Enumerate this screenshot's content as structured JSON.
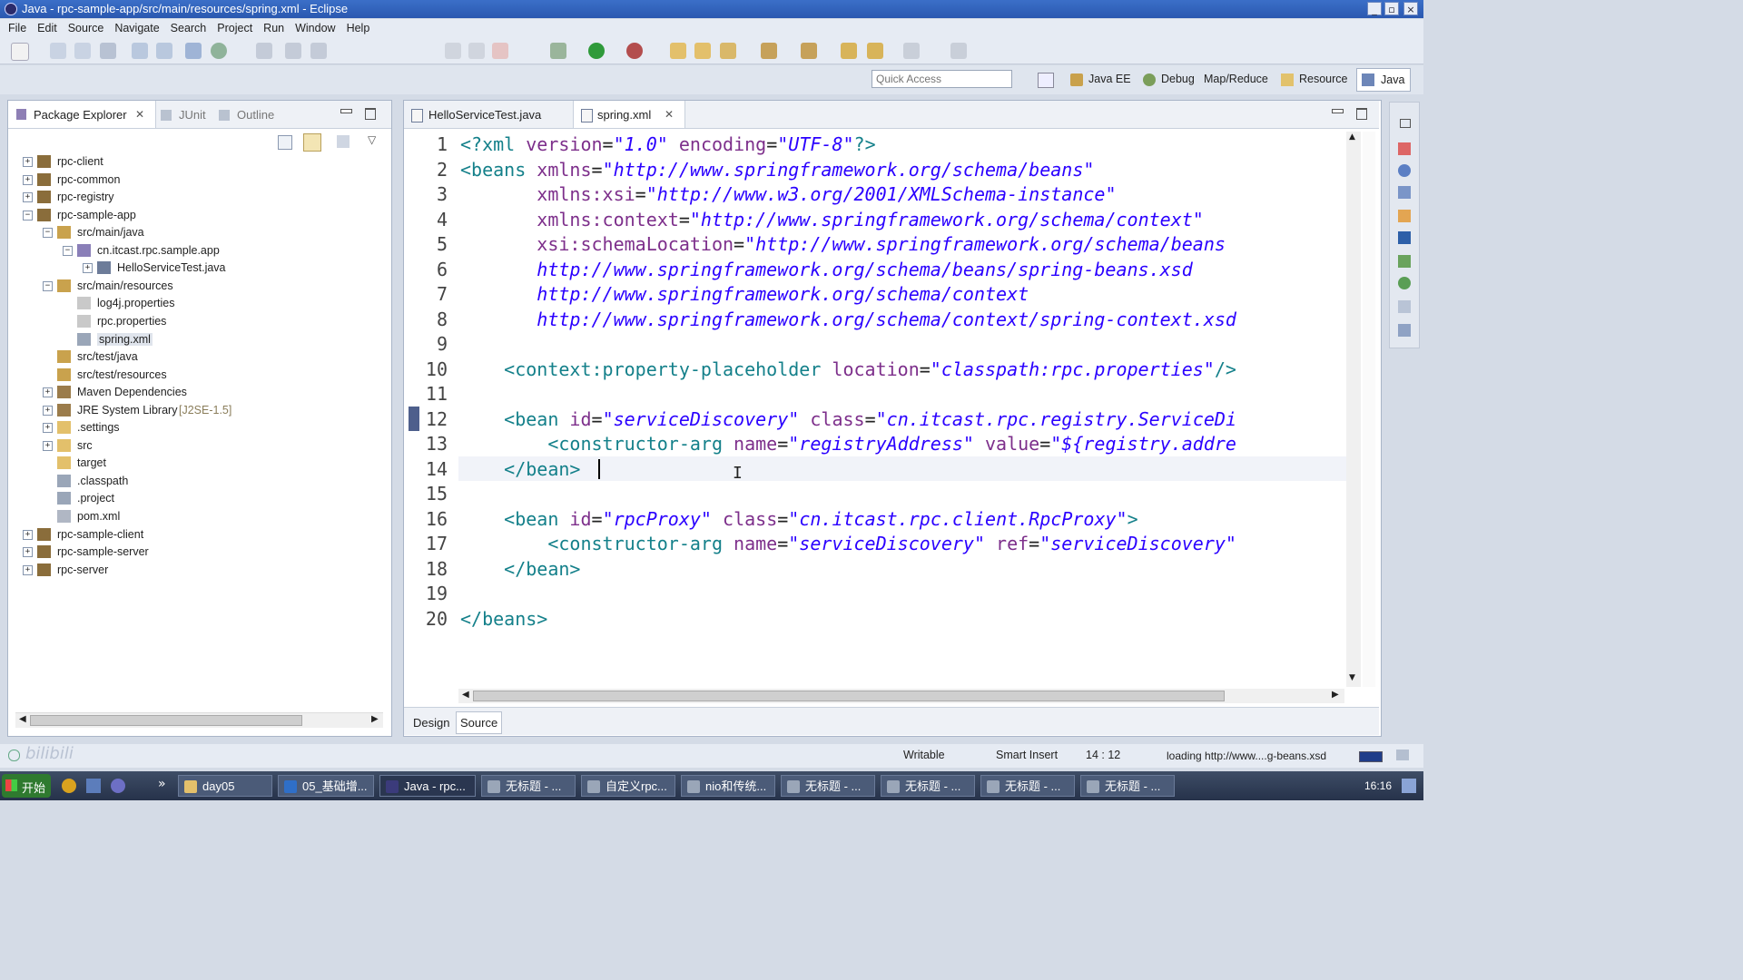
{
  "window": {
    "title": "Java - rpc-sample-app/src/main/resources/spring.xml - Eclipse",
    "controls": [
      "_",
      "▫",
      "×"
    ]
  },
  "menu": [
    "File",
    "Edit",
    "Source",
    "Navigate",
    "Search",
    "Project",
    "Run",
    "Window",
    "Help"
  ],
  "quick_access": {
    "placeholder": "Quick Access"
  },
  "perspectives": [
    "Java EE",
    "Debug",
    "Map/Reduce",
    "Resource",
    "Java"
  ],
  "left_panel": {
    "tabs": [
      "Package Explorer",
      "JUnit",
      "Outline"
    ],
    "tree": [
      {
        "label": "rpc-client",
        "expander": "+"
      },
      {
        "label": "rpc-common",
        "expander": "+"
      },
      {
        "label": "rpc-registry",
        "expander": "+"
      },
      {
        "label": "rpc-sample-app",
        "expander": "−"
      },
      {
        "label": "src/main/java",
        "expander": "−"
      },
      {
        "label": "cn.itcast.rpc.sample.app",
        "expander": "−"
      },
      {
        "label": "HelloServiceTest.java",
        "expander": "+"
      },
      {
        "label": "src/main/resources",
        "expander": "−"
      },
      {
        "label": "log4j.properties",
        "expander": ""
      },
      {
        "label": "rpc.properties",
        "expander": ""
      },
      {
        "label": "spring.xml",
        "expander": ""
      },
      {
        "label": "src/test/java",
        "expander": ""
      },
      {
        "label": "src/test/resources",
        "expander": ""
      },
      {
        "label": "Maven Dependencies",
        "expander": "+"
      },
      {
        "label": "JRE System Library",
        "suffix": "[J2SE-1.5]",
        "expander": "+"
      },
      {
        "label": ".settings",
        "expander": "+"
      },
      {
        "label": "src",
        "expander": "+"
      },
      {
        "label": "target",
        "expander": ""
      },
      {
        "label": ".classpath",
        "expander": ""
      },
      {
        "label": ".project",
        "expander": ""
      },
      {
        "label": "pom.xml",
        "expander": ""
      },
      {
        "label": "rpc-sample-client",
        "expander": "+"
      },
      {
        "label": "rpc-sample-server",
        "expander": "+"
      },
      {
        "label": "rpc-server",
        "expander": "+"
      }
    ]
  },
  "editor": {
    "tabs": [
      "HelloServiceTest.java",
      "spring.xml"
    ],
    "bottom_tabs": [
      "Design",
      "Source"
    ],
    "lines": [
      {
        "n": "1",
        "segs": [
          [
            "pi",
            "<?xml "
          ],
          [
            "attr",
            "version"
          ],
          [
            "txt",
            "="
          ],
          [
            "str",
            "\"1.0\""
          ],
          [
            "txt",
            " "
          ],
          [
            "attr",
            "encoding"
          ],
          [
            "txt",
            "="
          ],
          [
            "str",
            "\"UTF-8\""
          ],
          [
            "pi",
            "?>"
          ]
        ]
      },
      {
        "n": "2",
        "segs": [
          [
            "tag",
            "<beans "
          ],
          [
            "attr",
            "xmlns"
          ],
          [
            "txt",
            "="
          ],
          [
            "str",
            "\"http://www.springframework.org/schema/beans\""
          ]
        ]
      },
      {
        "n": "3",
        "segs": [
          [
            "txt",
            "       "
          ],
          [
            "attr",
            "xmlns:xsi"
          ],
          [
            "txt",
            "="
          ],
          [
            "str",
            "\"http://www.w3.org/2001/XMLSchema-instance\""
          ]
        ]
      },
      {
        "n": "4",
        "segs": [
          [
            "txt",
            "       "
          ],
          [
            "attr",
            "xmlns:context"
          ],
          [
            "txt",
            "="
          ],
          [
            "str",
            "\"http://www.springframework.org/schema/context\""
          ]
        ]
      },
      {
        "n": "5",
        "segs": [
          [
            "txt",
            "       "
          ],
          [
            "attr",
            "xsi:schemaLocation"
          ],
          [
            "txt",
            "="
          ],
          [
            "str",
            "\"http://www.springframework.org/schema/beans"
          ]
        ]
      },
      {
        "n": "6",
        "segs": [
          [
            "txt",
            "       "
          ],
          [
            "str",
            "http://www.springframework.org/schema/beans/spring-beans.xsd"
          ]
        ]
      },
      {
        "n": "7",
        "segs": [
          [
            "txt",
            "       "
          ],
          [
            "str",
            "http://www.springframework.org/schema/context"
          ]
        ]
      },
      {
        "n": "8",
        "segs": [
          [
            "txt",
            "       "
          ],
          [
            "str",
            "http://www.springframework.org/schema/context/spring-context.xsd"
          ]
        ]
      },
      {
        "n": "9",
        "segs": []
      },
      {
        "n": "10",
        "segs": [
          [
            "txt",
            "    "
          ],
          [
            "tag",
            "<context:property-placeholder "
          ],
          [
            "attr",
            "location"
          ],
          [
            "txt",
            "="
          ],
          [
            "str",
            "\"classpath:rpc.properties\""
          ],
          [
            "tag",
            "/>"
          ]
        ]
      },
      {
        "n": "11",
        "segs": []
      },
      {
        "n": "12",
        "segs": [
          [
            "txt",
            "    "
          ],
          [
            "tag",
            "<bean "
          ],
          [
            "attr",
            "id"
          ],
          [
            "txt",
            "="
          ],
          [
            "str",
            "\"serviceDiscovery\""
          ],
          [
            "txt",
            " "
          ],
          [
            "attr",
            "class"
          ],
          [
            "txt",
            "="
          ],
          [
            "str",
            "\"cn.itcast.rpc.registry.ServiceDi"
          ]
        ]
      },
      {
        "n": "13",
        "segs": [
          [
            "txt",
            "        "
          ],
          [
            "tag",
            "<constructor-arg "
          ],
          [
            "attr",
            "name"
          ],
          [
            "txt",
            "="
          ],
          [
            "str",
            "\"registryAddress\""
          ],
          [
            "txt",
            " "
          ],
          [
            "attr",
            "value"
          ],
          [
            "txt",
            "="
          ],
          [
            "str",
            "\"${registry.addre"
          ]
        ]
      },
      {
        "n": "14",
        "segs": [
          [
            "txt",
            "    "
          ],
          [
            "tag",
            "</bean>"
          ]
        ]
      },
      {
        "n": "15",
        "segs": []
      },
      {
        "n": "16",
        "segs": [
          [
            "txt",
            "    "
          ],
          [
            "tag",
            "<bean "
          ],
          [
            "attr",
            "id"
          ],
          [
            "txt",
            "="
          ],
          [
            "str",
            "\"rpcProxy\""
          ],
          [
            "txt",
            " "
          ],
          [
            "attr",
            "class"
          ],
          [
            "txt",
            "="
          ],
          [
            "str",
            "\"cn.itcast.rpc.client.RpcProxy\""
          ],
          [
            "tag",
            ">"
          ]
        ]
      },
      {
        "n": "17",
        "segs": [
          [
            "txt",
            "        "
          ],
          [
            "tag",
            "<constructor-arg "
          ],
          [
            "attr",
            "name"
          ],
          [
            "txt",
            "="
          ],
          [
            "str",
            "\"serviceDiscovery\""
          ],
          [
            "txt",
            " "
          ],
          [
            "attr",
            "ref"
          ],
          [
            "txt",
            "="
          ],
          [
            "str",
            "\"serviceDiscovery\""
          ]
        ]
      },
      {
        "n": "18",
        "segs": [
          [
            "txt",
            "    "
          ],
          [
            "tag",
            "</bean>"
          ]
        ]
      },
      {
        "n": "19",
        "segs": []
      },
      {
        "n": "20",
        "segs": [
          [
            "tag",
            "</beans>"
          ]
        ]
      }
    ]
  },
  "status": {
    "writable": "Writable",
    "insert_mode": "Smart Insert",
    "position": "14 : 12",
    "loading": "loading http://www....g-beans.xsd"
  },
  "taskbar": {
    "start": "开始",
    "items": [
      "day05",
      "05_基础增...",
      "Java - rpc...",
      "无标题 - ...",
      "自定义rpc...",
      "nio和传统...",
      "无标题 - ...",
      "无标题 - ...",
      "无标题 - ...",
      "无标题 - ..."
    ],
    "clock": "16:16"
  },
  "colors": {
    "tag": "#14808a",
    "attr": "#7d2f8b",
    "string": "#2a00ff"
  }
}
